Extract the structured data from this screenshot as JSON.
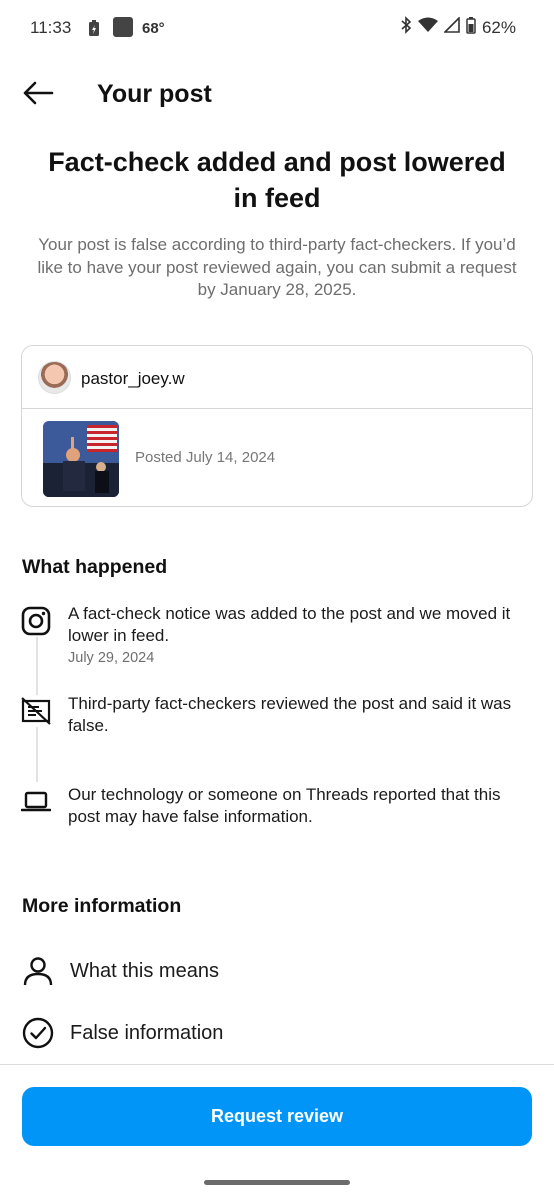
{
  "status_bar": {
    "time": "11:33",
    "temperature": "68°",
    "battery_percent": "62%",
    "icons": [
      "battery-saver-icon",
      "news-icon",
      "bluetooth-icon",
      "wifi-icon",
      "signal-icon",
      "battery-icon"
    ]
  },
  "header": {
    "back_icon": "arrow-left-icon",
    "title": "Your post"
  },
  "notice": {
    "title": "Fact-check added and post lowered in feed",
    "description": "Your post is false according to third-party fact-checkers. If you’d like to have your post reviewed again, you can submit a request by January 28, 2025."
  },
  "post": {
    "username": "pastor_joey.w",
    "posted": "Posted July 14, 2024"
  },
  "what_happened": {
    "title": "What happened",
    "events": [
      {
        "icon": "instagram-icon",
        "text": "A fact-check notice was added to the post and we moved it lower in feed.",
        "date": "July 29, 2024"
      },
      {
        "icon": "fact-check-icon",
        "text": "Third-party fact-checkers reviewed the post and said it was false.",
        "date": ""
      },
      {
        "icon": "laptop-icon",
        "text": "Our technology or someone on Threads reported that this post may have false information.",
        "date": ""
      }
    ]
  },
  "more_information": {
    "title": "More information",
    "items": [
      {
        "icon": "person-icon",
        "label": "What this means"
      },
      {
        "icon": "check-circle-icon",
        "label": "False information"
      }
    ]
  },
  "actions": {
    "request_review": "Request review"
  },
  "colors": {
    "primary_button": "#0095f6",
    "muted_text": "#6e6e6e",
    "border": "#d6d6d6"
  }
}
